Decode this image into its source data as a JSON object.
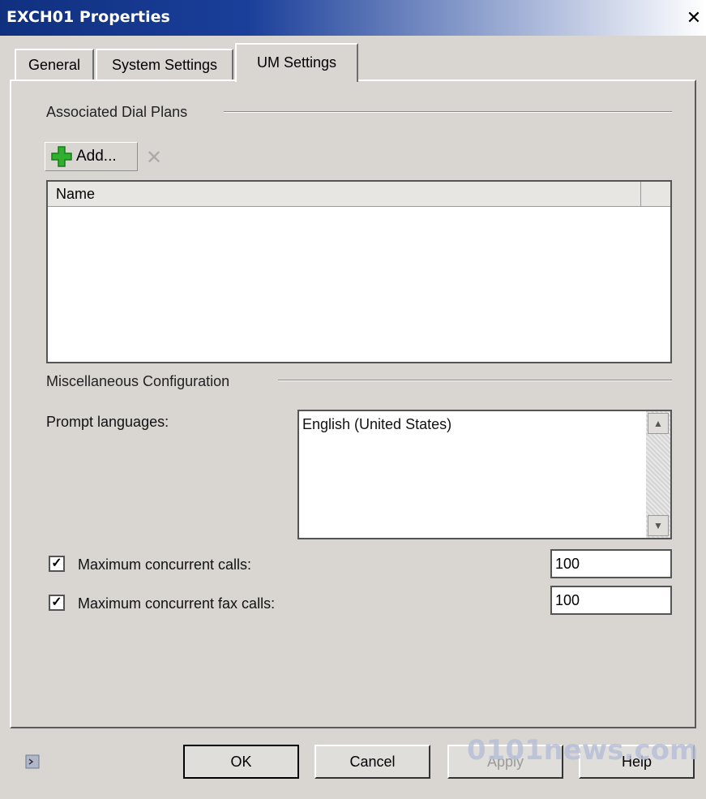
{
  "window": {
    "title": "EXCH01 Properties",
    "close_glyph": "✕"
  },
  "tabs": [
    {
      "label": "General"
    },
    {
      "label": "System Settings"
    },
    {
      "label": "UM Settings"
    }
  ],
  "associated": {
    "label": "Associated Dial Plans",
    "add_label": "Add...",
    "column": "Name"
  },
  "misc": {
    "label": "Miscellaneous Configuration",
    "prompt_label": "Prompt languages:",
    "languages": [
      "English (United States)"
    ]
  },
  "calls": {
    "max_calls_label": "Maximum concurrent calls:",
    "max_calls_value": "100",
    "max_fax_label": "Maximum concurrent fax calls:",
    "max_fax_value": "100"
  },
  "buttons": {
    "ok": "OK",
    "cancel": "Cancel",
    "apply": "Apply",
    "help": "Help"
  },
  "watermark": "0101news.com",
  "colors": {
    "title_bar": "#10307f",
    "dialog_bg": "#d9d6d2",
    "add_icon": "#2fb02f"
  }
}
